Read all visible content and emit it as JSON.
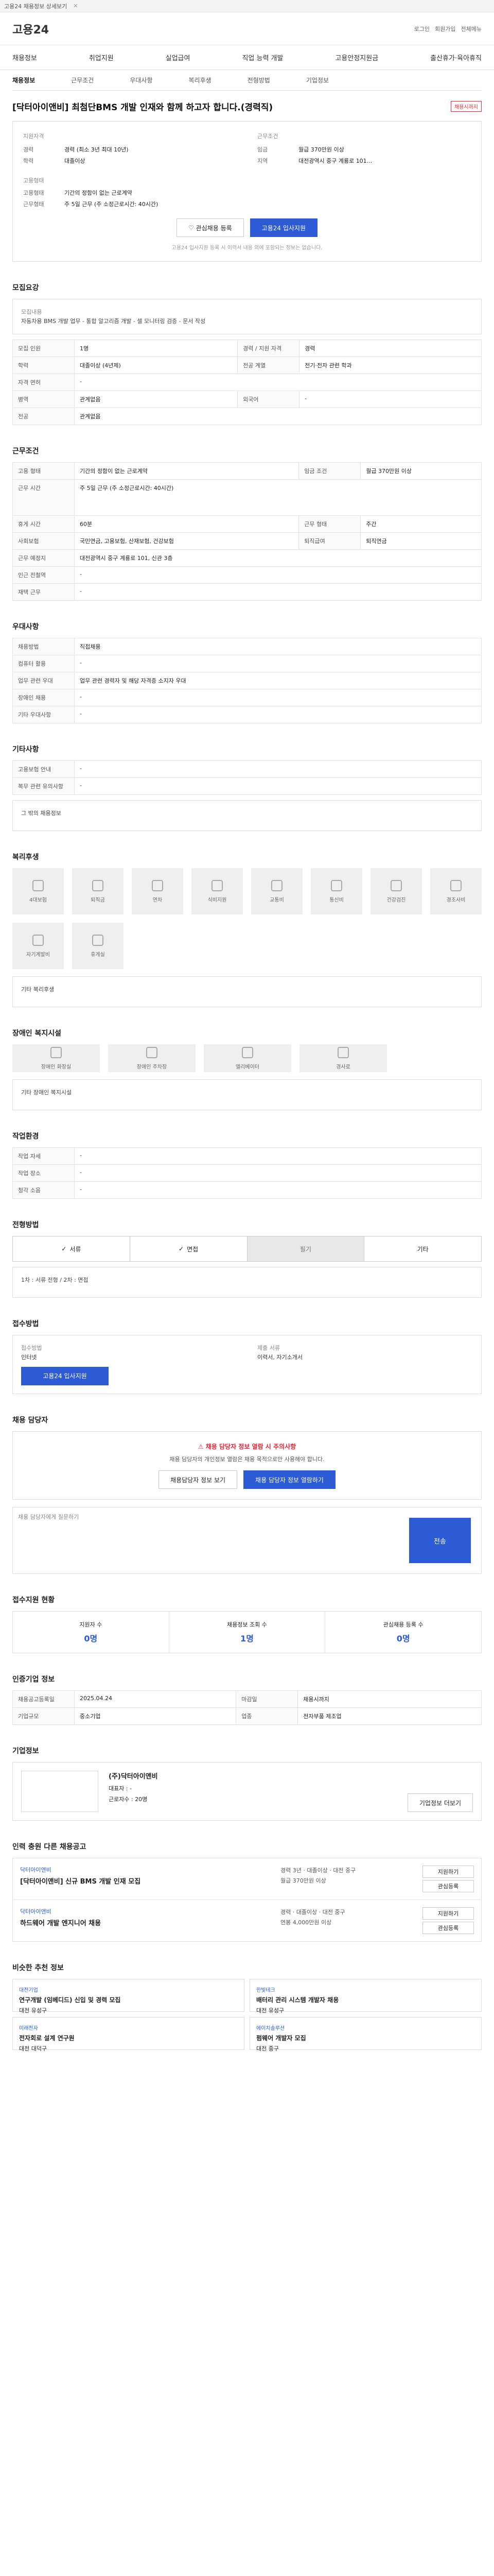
{
  "topbar": {
    "text": "고용24 채용정보 상세보기"
  },
  "header": {
    "logo": "고용24",
    "right": [
      "로그인",
      "회원가입",
      "전체메뉴"
    ]
  },
  "nav": [
    "채용정보",
    "취업지원",
    "실업급여",
    "직업 능력 개발",
    "고용안정지원금",
    "출산휴가·육아휴직"
  ],
  "subnav": [
    "채용정보",
    "근무조건",
    "우대사항",
    "복리후생",
    "전형방법",
    "기업정보"
  ],
  "job": {
    "title": "[닥터아이앤비] 최첨단BMS 개발 인재와 함께 하고자 합니다.(경력직)",
    "badge": "채용시까지"
  },
  "summary": {
    "left_title": "지원자격",
    "right_title": "근무조건",
    "career_k": "경력",
    "career_v": "경력 (최소 3년 최대 10년)",
    "edu_k": "학력",
    "edu_v": "대졸이상",
    "pay_k": "임금",
    "pay_v": "월급 370만원 이상",
    "area_k": "지역",
    "area_v": "대전광역시 중구 계룡로 101...",
    "type_title": "고용형태",
    "type_k": "고용형태",
    "type_v": "기간의 정함이 없는 근로계약",
    "hours_k": "근무형태",
    "hours_v": "주 5일 근무 (주 소정근로시간: 40시간)"
  },
  "buttons": {
    "interest": "관심채용 등록",
    "apply": "고용24 입사지원"
  },
  "notice": "고용24 입사지원 등록 시 이력서 내용 외에 포함되는 정보는 없습니다.",
  "s1": {
    "title": "모집요강",
    "title_label": "모집내용",
    "desc": "자동차용 BMS 개발 업무 - 통합 알고리즘 개발 - 셀 모니터링 검증 - 문서 작성",
    "rows": [
      [
        "모집 인원",
        "1명",
        "경력 / 지원 자격",
        "경력"
      ],
      [
        "학력",
        "대졸이상 (4년제)",
        "전공 계열",
        "전기·전자 관련 학과"
      ],
      [
        "자격 면허",
        "-",
        "",
        ""
      ],
      [
        "병역",
        "관계없음",
        "외국어",
        "-"
      ],
      [
        "전공",
        "관계없음",
        "",
        ""
      ]
    ]
  },
  "s2": {
    "title": "근무조건",
    "rows": [
      [
        "고용 형태",
        "기간의 정함이 없는 근로계약",
        "임금 조건",
        "월급 370만원 이상"
      ],
      [
        "근무 시간",
        "주 5일 근무 (주 소정근로시간: 40시간)",
        "",
        ""
      ],
      [
        "휴게 시간",
        "60분",
        "근무 형태",
        "주간"
      ],
      [
        "사회보험",
        "국민연금, 고용보험, 산재보험, 건강보험",
        "퇴직급여",
        "퇴직연금"
      ],
      [
        "근무 예정지",
        "대전광역시 중구 계룡로 101, 신관 3층",
        "",
        ""
      ],
      [
        "인근 전철역",
        "-",
        "",
        ""
      ],
      [
        "재택 근무",
        "-",
        "",
        ""
      ]
    ]
  },
  "s3": {
    "title": "우대사항",
    "rows": [
      [
        "채용방법",
        "직접채용"
      ],
      [
        "컴퓨터 활용",
        "-"
      ],
      [
        "업무 관련 우대",
        "업무 관련 경력자 및 해당 자격증 소지자 우대"
      ],
      [
        "장애인 채용",
        "-"
      ],
      [
        "기타 우대사항",
        "-"
      ]
    ]
  },
  "s4": {
    "title": "기타사항",
    "rows": [
      [
        "고용보험 안내",
        "-"
      ],
      [
        "복무 관련 유의사항",
        "-"
      ]
    ],
    "extra": "그 밖의 채용정보"
  },
  "s5": {
    "title": "복리후생",
    "items": [
      "4대보험",
      "퇴직금",
      "연차",
      "식비지원",
      "교통비",
      "통신비",
      "건강검진",
      "경조사비",
      "자기계발비",
      "휴게실"
    ],
    "extra": "기타 복리후생"
  },
  "s6": {
    "title": "장애인 복지시설",
    "items": [
      "장애인 화장실",
      "장애인 주차장",
      "엘리베이터",
      "경사로"
    ],
    "extra": "기타 장애인 복지시설"
  },
  "s7": {
    "title": "작업환경",
    "rows": [
      [
        "작업 자세",
        "-",
        "",
        ""
      ],
      [
        "작업 장소",
        "-",
        "",
        ""
      ],
      [
        "청각 소음",
        "-",
        "",
        ""
      ]
    ]
  },
  "s8": {
    "title": "전형방법",
    "steps": [
      "서류",
      "면접",
      "필기",
      "기타"
    ],
    "detail": "1차 : 서류 전형 / 2차 : 면접"
  },
  "s9": {
    "title": "접수방법",
    "left_k": "접수방법",
    "left_v": "인터넷",
    "right_k": "제출 서류",
    "right_v": "이력서, 자기소개서",
    "apply_btn": "고용24 입사지원"
  },
  "s10": {
    "title": "채용 담당자",
    "alert": "채용 담당자 정보 열람 시 주의사항",
    "desc": "채용 담당자의 개인정보 열람은 채용 목적으로만 사용해야 합니다.",
    "b1": "채용담당자 정보 보기",
    "b2": "채용 담당자 정보 열람하기",
    "form_placeholder": "채용 담당자에게 질문하기",
    "submit": "전송"
  },
  "s11": {
    "title": "접수지원 현황",
    "stats": [
      [
        "지원자 수",
        "0명"
      ],
      [
        "채용정보 조회 수",
        "1명"
      ],
      [
        "관심채용 등록 수",
        "0명"
      ]
    ]
  },
  "s12": {
    "title": "인증기업 정보",
    "rows": [
      [
        "채용공고등록일",
        "2025.04.24",
        "마감일",
        "채용시까지"
      ],
      [
        "기업규모",
        "중소기업",
        "업종",
        "전자부품 제조업"
      ]
    ]
  },
  "s13": {
    "title": "기업정보",
    "name": "(주)닥터아이앤비",
    "ceo_k": "대표자",
    "ceo_v": "-",
    "emp_k": "근로자수",
    "emp_v": "20명",
    "btn": "기업정보 더보기"
  },
  "s14": {
    "title": "인력 충원 다른 채용공고",
    "jobs": [
      {
        "company": "닥터아이앤비",
        "title": "[닥터아이앤비] 신규 BMS 개발 인재 모집",
        "info": "경력 3년 · 대졸이상 · 대전 중구",
        "pay": "월급 370만원 이상",
        "a1": "지원하기",
        "a2": "관심등록"
      },
      {
        "company": "닥터아이앤비",
        "title": "하드웨어 개발 엔지니어 채용",
        "info": "경력 · 대졸이상 · 대전 중구",
        "pay": "연봉 4,000만원 이상",
        "a1": "지원하기",
        "a2": "관심등록"
      }
    ]
  },
  "s15": {
    "title": "비슷한 추천 정보",
    "cards": [
      {
        "company": "대전기업",
        "title": "연구개발 (임베디드) 신입 및 경력 모집",
        "loc": "대전 유성구"
      },
      {
        "company": "한빛테크",
        "title": "배터리 관리 시스템 개발자 채용",
        "loc": "대전 유성구"
      },
      {
        "company": "미래전자",
        "title": "전자회로 설계 연구원",
        "loc": "대전 대덕구"
      },
      {
        "company": "에이치솔루션",
        "title": "펌웨어 개발자 모집",
        "loc": "대전 중구"
      }
    ]
  }
}
